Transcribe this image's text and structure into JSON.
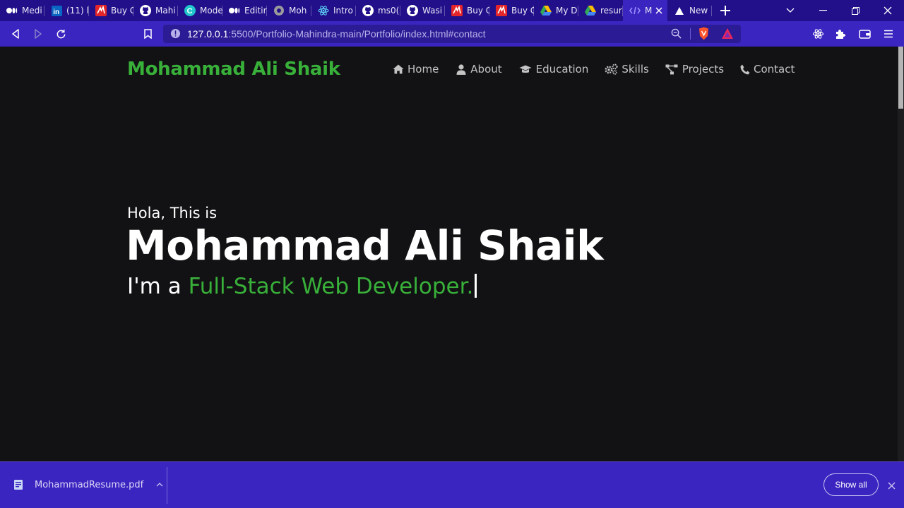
{
  "browser": {
    "tabs": [
      {
        "title": "Medi",
        "icon": "medium-icon"
      },
      {
        "title": "(11) l",
        "icon": "linkedin-icon"
      },
      {
        "title": "Buy C",
        "icon": "store-icon"
      },
      {
        "title": "Mahi",
        "icon": "github-icon"
      },
      {
        "title": "Mode",
        "icon": "canva-icon"
      },
      {
        "title": "Editir",
        "icon": "medium-icon"
      },
      {
        "title": "Moh",
        "icon": "globe-icon"
      },
      {
        "title": "Intro",
        "icon": "react-icon"
      },
      {
        "title": "ms0(",
        "icon": "github-icon"
      },
      {
        "title": "Wasi",
        "icon": "github-icon"
      },
      {
        "title": "Buy C",
        "icon": "store-icon"
      },
      {
        "title": "Buy C",
        "icon": "store-icon"
      },
      {
        "title": "My D",
        "icon": "drive-icon"
      },
      {
        "title": "resur",
        "icon": "drive-icon"
      },
      {
        "title": "M",
        "icon": "code-icon",
        "active": true
      },
      {
        "title": "New",
        "icon": "new-tab-icon"
      }
    ],
    "address": {
      "host": "127.0.0.1",
      "rest": ":5500/Portfolio-Mahindra-main/Portfolio/index.html#contact"
    },
    "colors": {
      "accent": "#3a25c0",
      "tabstrip": "#21108a"
    }
  },
  "site": {
    "brand": "Mohammad Ali Shaik",
    "nav": [
      {
        "label": "Home",
        "icon": "home-icon"
      },
      {
        "label": "About",
        "icon": "user-icon"
      },
      {
        "label": "Education",
        "icon": "graduation-cap-icon"
      },
      {
        "label": "Skills",
        "icon": "gears-icon"
      },
      {
        "label": "Projects",
        "icon": "project-diagram-icon"
      },
      {
        "label": "Contact",
        "icon": "phone-icon"
      }
    ],
    "hero": {
      "greeting": "Hola, This is",
      "name": "Mohammad Ali Shaik",
      "tagline_prefix": "I'm a ",
      "tagline_role": "Full-Stack Web Developer."
    },
    "colors": {
      "accent": "#38b03a",
      "background": "#121113"
    }
  },
  "downloads": {
    "file": "MohammadResume.pdf",
    "show_all": "Show all"
  }
}
